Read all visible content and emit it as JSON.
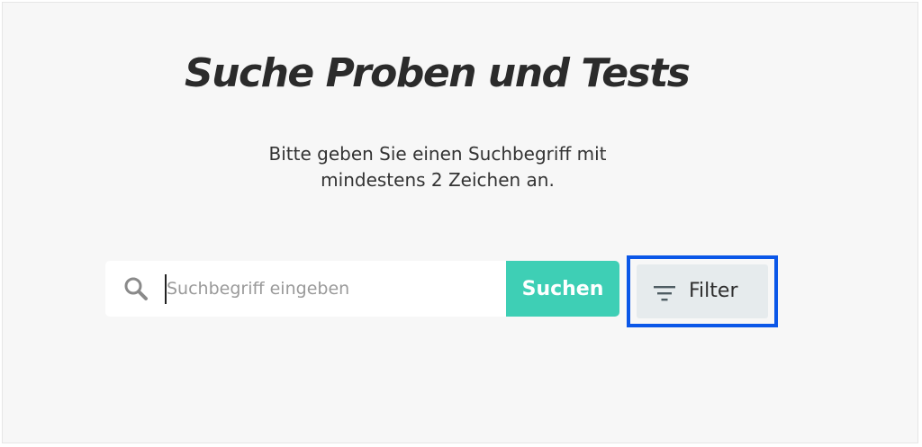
{
  "page": {
    "title": "Suche Proben und Tests",
    "instruction_line1": "Bitte geben Sie einen Suchbegriff mit",
    "instruction_line2": "mindestens 2 Zeichen an."
  },
  "search": {
    "placeholder": "Suchbegriff eingeben",
    "value": "",
    "button_label": "Suchen",
    "icon": "search-icon"
  },
  "filter": {
    "button_label": "Filter",
    "icon": "filter-icon",
    "focused": true
  },
  "colors": {
    "background": "#f7f7f7",
    "accent": "#3ecfb5",
    "focus_ring": "#0b57e8",
    "filter_button_bg": "#e6ebed",
    "title_text": "#2b2b2b"
  }
}
